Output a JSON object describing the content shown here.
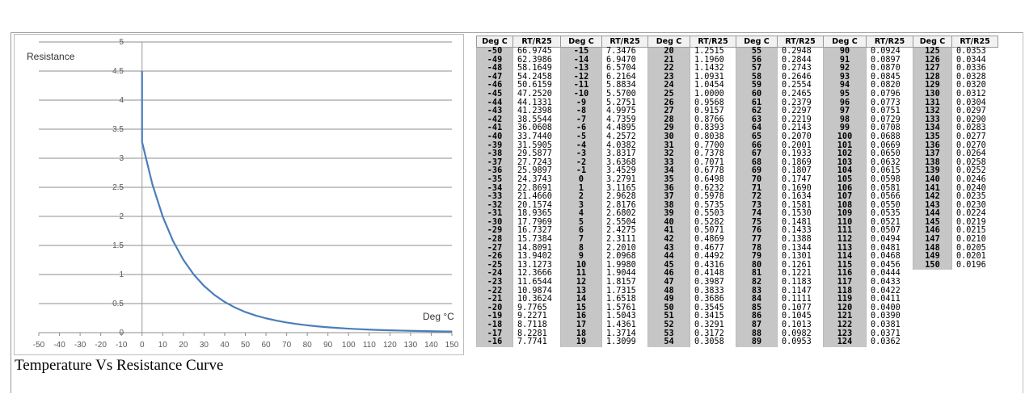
{
  "chart_data": {
    "type": "line",
    "ylabel": "Resistance",
    "xlabel": "Deg °C",
    "xlim": [
      -50,
      150
    ],
    "ylim": [
      0,
      5
    ],
    "x_ticks": [
      "-50",
      "-40",
      "-30",
      "-20",
      "-10",
      "0",
      "10",
      "20",
      "30",
      "40",
      "50",
      "60",
      "70",
      "80",
      "90",
      "100",
      "110",
      "120",
      "130",
      "140",
      "150"
    ],
    "y_ticks": [
      "0",
      "0.5",
      "1",
      "1.5",
      "2",
      "2.5",
      "3",
      "3.5",
      "4",
      "4.5",
      "5"
    ],
    "grid": "horizontal",
    "series_color": "#4a7ebb",
    "series": [
      {
        "x": [
          0,
          5,
          10,
          15,
          20,
          25,
          30,
          35,
          40,
          45,
          50,
          55,
          60,
          65,
          70,
          75,
          80,
          85,
          90,
          95,
          100,
          105,
          110,
          115,
          120,
          125,
          130,
          135,
          140,
          145,
          150
        ],
        "values": [
          3.2791,
          2.5504,
          1.998,
          1.5761,
          1.2515,
          1.0,
          0.8038,
          0.6498,
          0.5282,
          0.4316,
          0.3545,
          0.2948,
          0.2465,
          0.207,
          0.1747,
          0.1481,
          0.1261,
          0.1077,
          0.0924,
          0.0796,
          0.0688,
          0.0598,
          0.0521,
          0.0456,
          0.04,
          0.0353,
          0.0312,
          0.0277,
          0.0246,
          0.0219,
          0.0196
        ]
      }
    ],
    "start_point": {
      "x": 0,
      "y": 4.5
    }
  },
  "caption": "Temperature Vs Resistance Curve",
  "table": {
    "headers": [
      "Deg C",
      "RT/R25",
      "Deg C",
      "RT/R25",
      "Deg C",
      "RT/R25",
      "Deg C",
      "RT/R25",
      "Deg C",
      "RT/R25",
      "Deg C",
      "RT/R25"
    ],
    "rows": [
      [
        "-50",
        "66.9745",
        "-15",
        "7.3476",
        "20",
        "1.2515",
        "55",
        "0.2948",
        "90",
        "0.0924",
        "125",
        "0.0353"
      ],
      [
        "-49",
        "62.3986",
        "-14",
        "6.9470",
        "21",
        "1.1960",
        "56",
        "0.2844",
        "91",
        "0.0897",
        "126",
        "0.0344"
      ],
      [
        "-48",
        "58.1649",
        "-13",
        "6.5704",
        "22",
        "1.1432",
        "57",
        "0.2743",
        "92",
        "0.0870",
        "127",
        "0.0336"
      ],
      [
        "-47",
        "54.2458",
        "-12",
        "6.2164",
        "23",
        "1.0931",
        "58",
        "0.2646",
        "93",
        "0.0845",
        "128",
        "0.0328"
      ],
      [
        "-46",
        "50.6159",
        "-11",
        "5.8834",
        "24",
        "1.0454",
        "59",
        "0.2554",
        "94",
        "0.0820",
        "129",
        "0.0320"
      ],
      [
        "-45",
        "47.2520",
        "-10",
        "5.5700",
        "25",
        "1.0000",
        "60",
        "0.2465",
        "95",
        "0.0796",
        "130",
        "0.0312"
      ],
      [
        "-44",
        "44.1331",
        "-9",
        "5.2751",
        "26",
        "0.9568",
        "61",
        "0.2379",
        "96",
        "0.0773",
        "131",
        "0.0304"
      ],
      [
        "-43",
        "41.2398",
        "-8",
        "4.9975",
        "27",
        "0.9157",
        "62",
        "0.2297",
        "97",
        "0.0751",
        "132",
        "0.0297"
      ],
      [
        "-42",
        "38.5544",
        "-7",
        "4.7359",
        "28",
        "0.8766",
        "63",
        "0.2219",
        "98",
        "0.0729",
        "133",
        "0.0290"
      ],
      [
        "-41",
        "36.0608",
        "-6",
        "4.4895",
        "29",
        "0.8393",
        "64",
        "0.2143",
        "99",
        "0.0708",
        "134",
        "0.0283"
      ],
      [
        "-40",
        "33.7440",
        "-5",
        "4.2572",
        "30",
        "0.8038",
        "65",
        "0.2070",
        "100",
        "0.0688",
        "135",
        "0.0277"
      ],
      [
        "-39",
        "31.5905",
        "-4",
        "4.0382",
        "31",
        "0.7700",
        "66",
        "0.2001",
        "101",
        "0.0669",
        "136",
        "0.0270"
      ],
      [
        "-38",
        "29.5877",
        "-3",
        "3.8317",
        "32",
        "0.7378",
        "67",
        "0.1933",
        "102",
        "0.0650",
        "137",
        "0.0264"
      ],
      [
        "-37",
        "27.7243",
        "-2",
        "3.6368",
        "33",
        "0.7071",
        "68",
        "0.1869",
        "103",
        "0.0632",
        "138",
        "0.0258"
      ],
      [
        "-36",
        "25.9897",
        "-1",
        "3.4529",
        "34",
        "0.6778",
        "69",
        "0.1807",
        "104",
        "0.0615",
        "139",
        "0.0252"
      ],
      [
        "-35",
        "24.3743",
        "0",
        "3.2791",
        "35",
        "0.6498",
        "70",
        "0.1747",
        "105",
        "0.0598",
        "140",
        "0.0246"
      ],
      [
        "-34",
        "22.8691",
        "1",
        "3.1165",
        "36",
        "0.6232",
        "71",
        "0.1690",
        "106",
        "0.0581",
        "141",
        "0.0240"
      ],
      [
        "-33",
        "21.4660",
        "2",
        "2.9628",
        "37",
        "0.5978",
        "72",
        "0.1634",
        "107",
        "0.0566",
        "142",
        "0.0235"
      ],
      [
        "-32",
        "20.1574",
        "3",
        "2.8176",
        "38",
        "0.5735",
        "73",
        "0.1581",
        "108",
        "0.0550",
        "143",
        "0.0230"
      ],
      [
        "-31",
        "18.9365",
        "4",
        "2.6802",
        "39",
        "0.5503",
        "74",
        "0.1530",
        "109",
        "0.0535",
        "144",
        "0.0224"
      ],
      [
        "-30",
        "17.7969",
        "5",
        "2.5504",
        "40",
        "0.5282",
        "75",
        "0.1481",
        "110",
        "0.0521",
        "145",
        "0.0219"
      ],
      [
        "-29",
        "16.7327",
        "6",
        "2.4275",
        "41",
        "0.5071",
        "76",
        "0.1433",
        "111",
        "0.0507",
        "146",
        "0.0215"
      ],
      [
        "-28",
        "15.7384",
        "7",
        "2.3111",
        "42",
        "0.4869",
        "77",
        "0.1388",
        "112",
        "0.0494",
        "147",
        "0.0210"
      ],
      [
        "-27",
        "14.8091",
        "8",
        "2.2010",
        "43",
        "0.4677",
        "78",
        "0.1344",
        "113",
        "0.0481",
        "148",
        "0.0205"
      ],
      [
        "-26",
        "13.9402",
        "9",
        "2.0968",
        "44",
        "0.4492",
        "79",
        "0.1301",
        "114",
        "0.0468",
        "149",
        "0.0201"
      ],
      [
        "-25",
        "13.1273",
        "10",
        "1.9980",
        "45",
        "0.4316",
        "80",
        "0.1261",
        "115",
        "0.0456",
        "150",
        "0.0196"
      ],
      [
        "-24",
        "12.3666",
        "11",
        "1.9044",
        "46",
        "0.4148",
        "81",
        "0.1221",
        "116",
        "0.0444",
        "",
        ""
      ],
      [
        "-23",
        "11.6544",
        "12",
        "1.8157",
        "47",
        "0.3987",
        "82",
        "0.1183",
        "117",
        "0.0433",
        "",
        ""
      ],
      [
        "-22",
        "10.9874",
        "13",
        "1.7315",
        "48",
        "0.3833",
        "83",
        "0.1147",
        "118",
        "0.0422",
        "",
        ""
      ],
      [
        "-21",
        "10.3624",
        "14",
        "1.6518",
        "49",
        "0.3686",
        "84",
        "0.1111",
        "119",
        "0.0411",
        "",
        ""
      ],
      [
        "-20",
        "9.7765",
        "15",
        "1.5761",
        "50",
        "0.3545",
        "85",
        "0.1077",
        "120",
        "0.0400",
        "",
        ""
      ],
      [
        "-19",
        "9.2271",
        "16",
        "1.5043",
        "51",
        "0.3415",
        "86",
        "0.1045",
        "121",
        "0.0390",
        "",
        ""
      ],
      [
        "-18",
        "8.7118",
        "17",
        "1.4361",
        "52",
        "0.3291",
        "87",
        "0.1013",
        "122",
        "0.0381",
        "",
        ""
      ],
      [
        "-17",
        "8.2281",
        "18",
        "1.3714",
        "53",
        "0.3172",
        "88",
        "0.0982",
        "123",
        "0.0371",
        "",
        ""
      ],
      [
        "-16",
        "7.7741",
        "19",
        "1.3099",
        "54",
        "0.3058",
        "89",
        "0.0953",
        "124",
        "0.0362",
        "",
        ""
      ]
    ]
  }
}
